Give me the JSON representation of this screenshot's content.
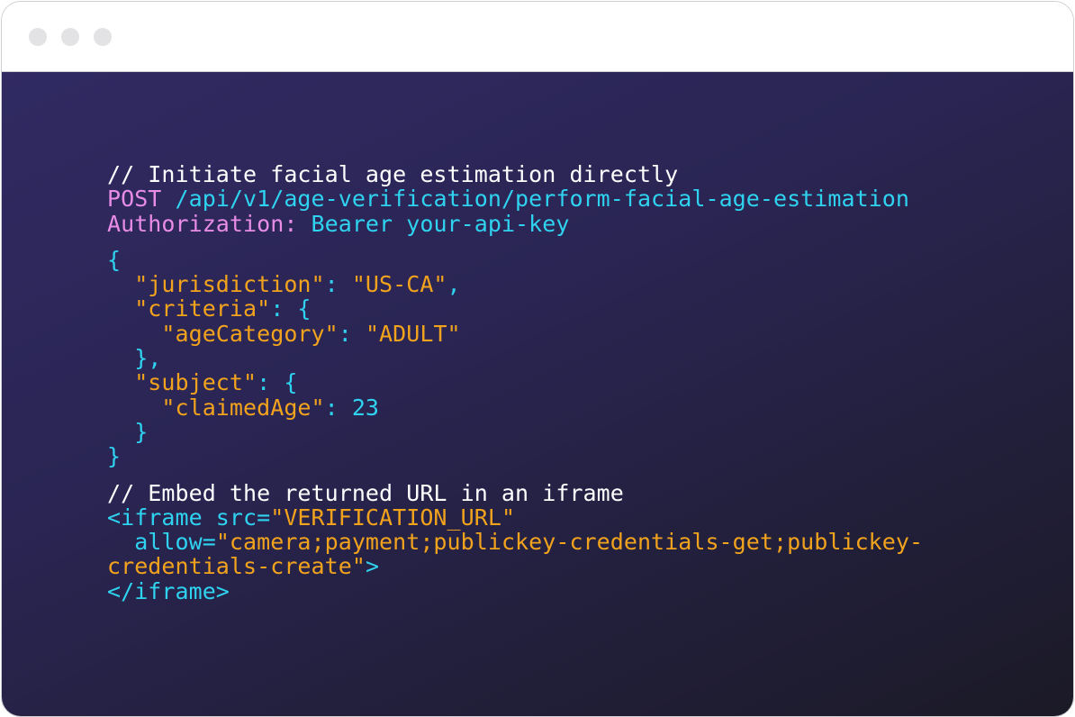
{
  "window": {
    "controls": [
      "dot-1",
      "dot-2",
      "dot-3"
    ]
  },
  "colors": {
    "titlebar_dot": "#e3e3e6",
    "editor_bg_top": "#312a63",
    "editor_bg_bottom": "#1b1a26",
    "comment": "#ffffff",
    "keyword": "#e88ce6",
    "cyan": "#2fd3f0",
    "string": "#f2a31d"
  },
  "code": {
    "lines": [
      [
        {
          "t": "// Initiate facial age estimation directly",
          "c": "comment"
        }
      ],
      [
        {
          "t": "POST ",
          "c": "keyword"
        },
        {
          "t": "/api/v1/age-verification/perform-facial-age-estimation",
          "c": "cyan"
        }
      ],
      [
        {
          "t": "Authorization: ",
          "c": "keyword"
        },
        {
          "t": "Bearer your-api-key",
          "c": "cyan"
        }
      ],
      [],
      [
        {
          "t": "{",
          "c": "cyan"
        }
      ],
      [
        {
          "t": "  ",
          "c": "cyan"
        },
        {
          "t": "\"jurisdiction\"",
          "c": "string"
        },
        {
          "t": ": ",
          "c": "cyan"
        },
        {
          "t": "\"US-CA\"",
          "c": "string"
        },
        {
          "t": ",",
          "c": "cyan"
        }
      ],
      [
        {
          "t": "  ",
          "c": "cyan"
        },
        {
          "t": "\"criteria\"",
          "c": "string"
        },
        {
          "t": ": {",
          "c": "cyan"
        }
      ],
      [
        {
          "t": "    ",
          "c": "cyan"
        },
        {
          "t": "\"ageCategory\"",
          "c": "string"
        },
        {
          "t": ": ",
          "c": "cyan"
        },
        {
          "t": "\"ADULT\"",
          "c": "string"
        }
      ],
      [
        {
          "t": "  },",
          "c": "cyan"
        }
      ],
      [
        {
          "t": "  ",
          "c": "cyan"
        },
        {
          "t": "\"subject\"",
          "c": "string"
        },
        {
          "t": ": {",
          "c": "cyan"
        }
      ],
      [
        {
          "t": "    ",
          "c": "cyan"
        },
        {
          "t": "\"claimedAge\"",
          "c": "string"
        },
        {
          "t": ": 23",
          "c": "cyan"
        }
      ],
      [
        {
          "t": "  }",
          "c": "cyan"
        }
      ],
      [
        {
          "t": "}",
          "c": "cyan"
        }
      ],
      [],
      [
        {
          "t": "// Embed the returned URL in an iframe",
          "c": "comment"
        }
      ],
      [
        {
          "t": "<iframe src=",
          "c": "cyan"
        },
        {
          "t": "\"VERIFICATION_URL\"",
          "c": "string"
        }
      ],
      [
        {
          "t": "  allow=",
          "c": "cyan"
        },
        {
          "t": "\"camera;payment;publickey-credentials-get;publickey-",
          "c": "string"
        }
      ],
      [
        {
          "t": "credentials-create\"",
          "c": "string"
        },
        {
          "t": ">",
          "c": "cyan"
        }
      ],
      [
        {
          "t": "</iframe>",
          "c": "cyan"
        }
      ]
    ]
  }
}
